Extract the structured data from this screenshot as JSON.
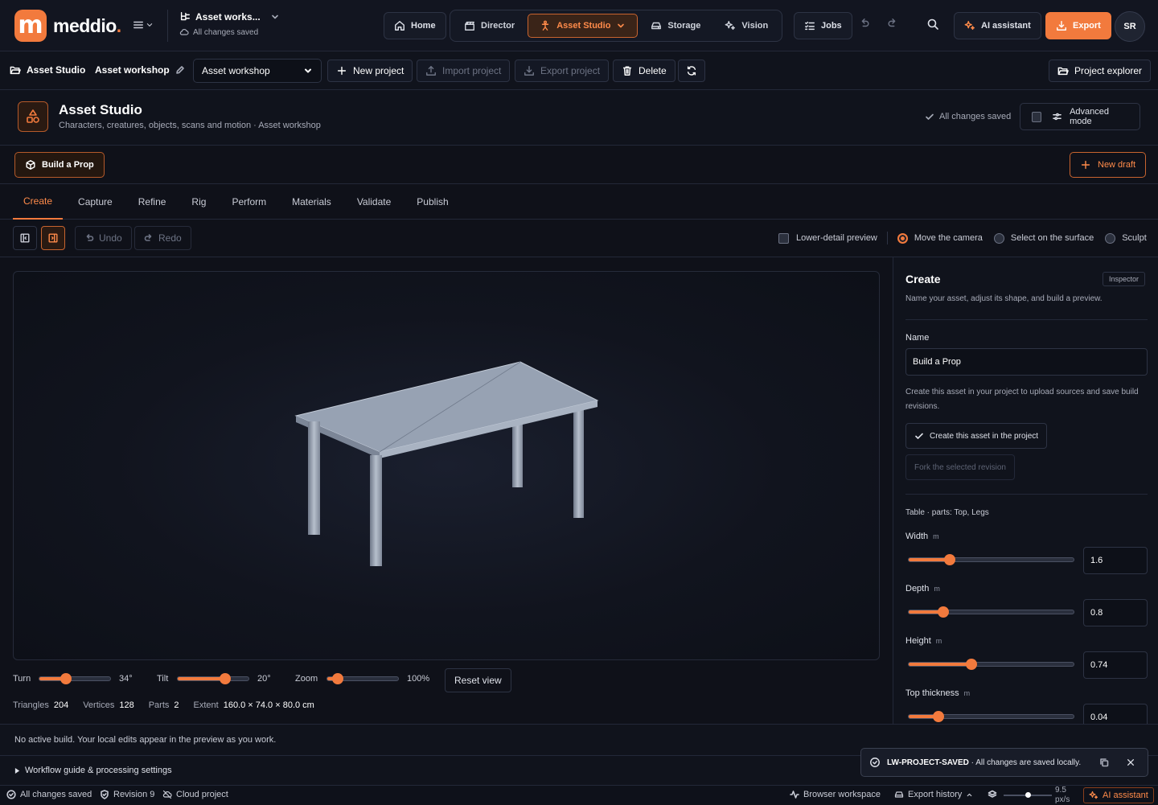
{
  "topbar": {
    "brand": "meddio",
    "brand_dot": ".",
    "workspace_title": "Asset works...",
    "workspace_status": "All changes saved",
    "home": "Home",
    "nav": [
      {
        "label": "Director"
      },
      {
        "label": "Asset Studio"
      },
      {
        "label": "Storage"
      },
      {
        "label": "Vision"
      }
    ],
    "jobs": "Jobs",
    "ai_assistant": "AI assistant",
    "export": "Export",
    "avatar_initials": "SR"
  },
  "projectbar": {
    "crumb_studio": "Asset Studio",
    "crumb_workshop": "Asset workshop",
    "select_value": "Asset workshop",
    "new_project": "New project",
    "import_project": "Import project",
    "export_project": "Export project",
    "delete": "Delete",
    "project_explorer": "Project explorer"
  },
  "header": {
    "title": "Asset Studio",
    "subtitle": "Characters, creatures, objects, scans and motion · Asset workshop",
    "saved": "All changes saved",
    "advanced_mode": "Advanced mode"
  },
  "assetbar": {
    "asset": "Build a Prop",
    "new_draft": "New draft"
  },
  "tabs": [
    "Create",
    "Capture",
    "Refine",
    "Rig",
    "Perform",
    "Materials",
    "Validate",
    "Publish"
  ],
  "toolbar": {
    "undo": "Undo",
    "redo": "Redo",
    "lower_detail": "Lower-detail preview",
    "modes": [
      "Move the camera",
      "Select on the surface",
      "Sculpt"
    ],
    "active_mode": "Move the camera"
  },
  "view_controls": {
    "turn": {
      "label": "Turn",
      "value": 34,
      "display": "34°",
      "min": 0,
      "max": 90
    },
    "tilt": {
      "label": "Tilt",
      "value": 20,
      "display": "20°",
      "min": 0,
      "max": 30
    },
    "zoom": {
      "label": "Zoom",
      "value": 100,
      "display": "100%",
      "min": 50,
      "max": 400
    },
    "reset": "Reset view"
  },
  "stats": {
    "triangles_label": "Triangles",
    "triangles": "204",
    "vertices_label": "Vertices",
    "vertices": "128",
    "parts_label": "Parts",
    "parts": "2",
    "extent_label": "Extent",
    "extent": "160.0 × 74.0 × 80.0 cm"
  },
  "inspector": {
    "title": "Create",
    "badge": "Inspector",
    "description": "Name your asset, adjust its shape, and build a preview.",
    "name_label": "Name",
    "name_value": "Build a Prop",
    "help": "Create this asset in your project to upload sources and save build revisions.",
    "create_button": "Create this asset in the project",
    "fork_button": "Fork the selected revision",
    "parts_line": "Table · parts: Top, Legs",
    "params": [
      {
        "label": "Width",
        "unit": "m",
        "value": "1.6",
        "fraction": 0.25
      },
      {
        "label": "Depth",
        "unit": "m",
        "value": "0.8",
        "fraction": 0.21
      },
      {
        "label": "Height",
        "unit": "m",
        "value": "0.74",
        "fraction": 0.38
      },
      {
        "label": "Top thickness",
        "unit": "m",
        "value": "0.04",
        "fraction": 0.18
      }
    ]
  },
  "status_line": "No active build. Your local edits appear in the preview as you work.",
  "guide": "Workflow guide & processing settings",
  "toast": {
    "code": "LW-PROJECT-SAVED",
    "message": " · All changes are saved locally."
  },
  "footer": {
    "saved": "All changes saved",
    "revision": "Revision 9",
    "cloud": "Cloud project",
    "browser_workspace": "Browser workspace",
    "export_history": "Export history",
    "scale": "9.5 px/s",
    "ai_assistant": "AI assistant"
  },
  "colors": {
    "accent": "#f27a3d",
    "background": "#0f1119",
    "panel": "#10131c"
  }
}
